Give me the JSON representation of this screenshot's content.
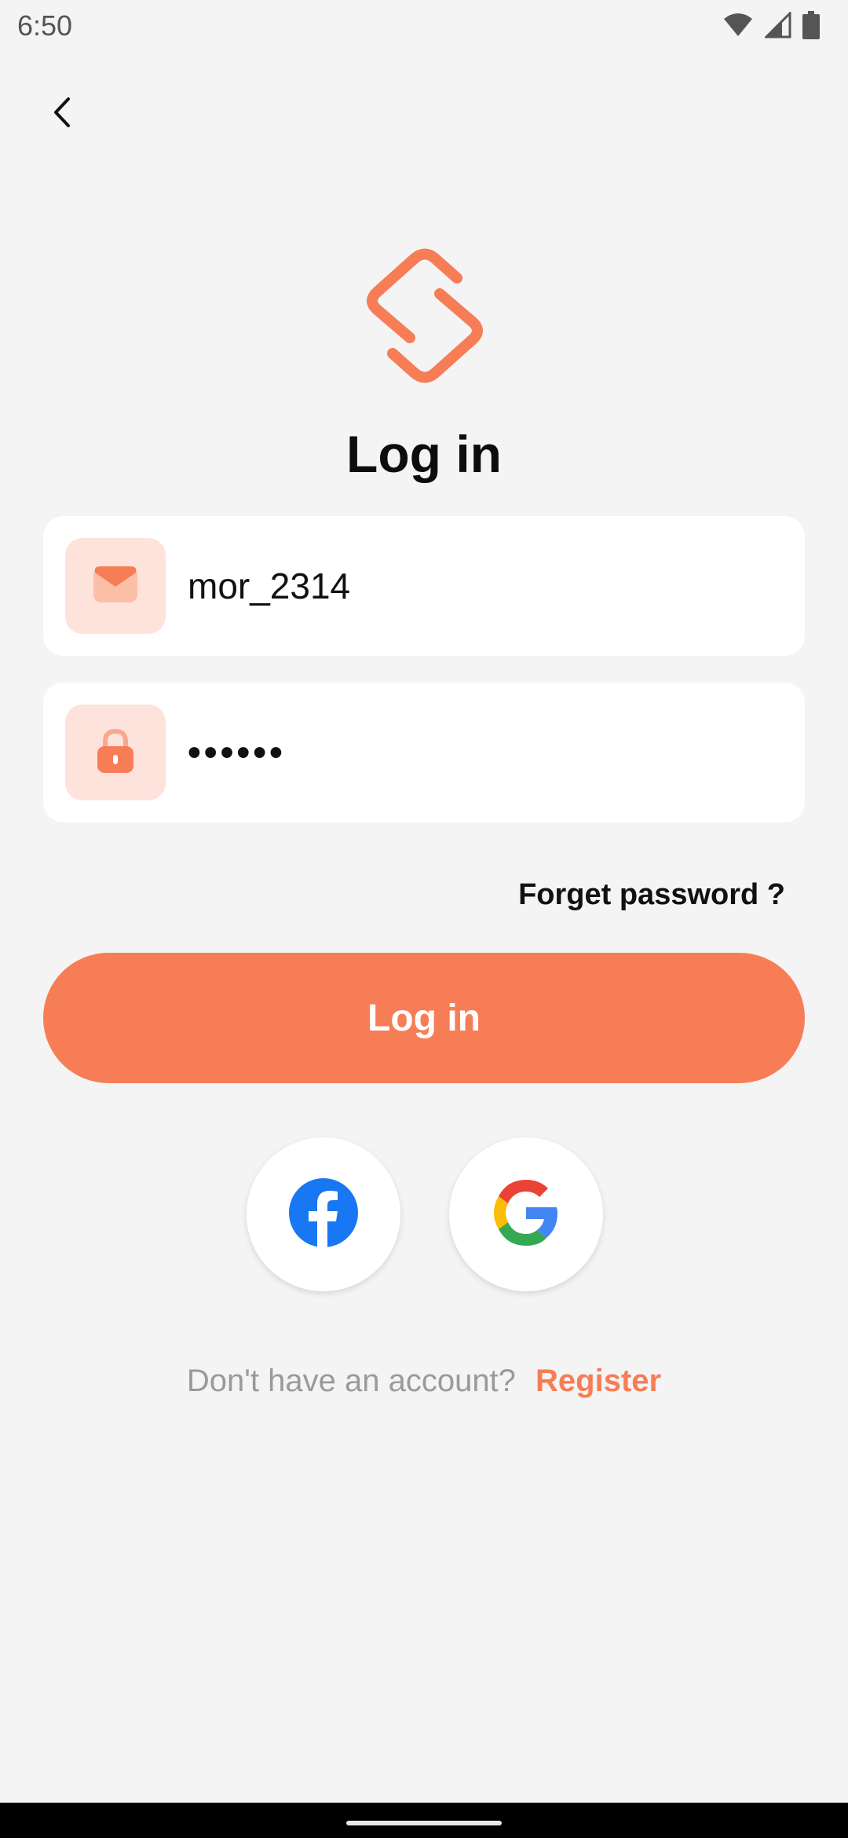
{
  "status_bar": {
    "time": "6:50",
    "icons": [
      "wifi-icon",
      "cellular-signal-icon",
      "battery-icon"
    ]
  },
  "nav": {
    "back_icon": "chevron-left-icon"
  },
  "logo": {
    "icon": "app-logo-icon",
    "color": "#f77d56"
  },
  "page": {
    "title": "Log in"
  },
  "form": {
    "email": {
      "icon": "envelope-icon",
      "value": "mor_2314"
    },
    "password": {
      "icon": "lock-icon",
      "value": "••••••"
    },
    "forgot_label": "Forget password ?",
    "submit_label": "Log in"
  },
  "social": [
    {
      "name": "facebook",
      "icon": "facebook-icon",
      "color": "#1877f2"
    },
    {
      "name": "google",
      "icon": "google-icon"
    }
  ],
  "footer": {
    "prompt": "Don't have an account?",
    "register_label": "Register"
  },
  "colors": {
    "accent": "#f77d56",
    "accent_light": "#fde3dc",
    "background": "#f4f4f4"
  }
}
